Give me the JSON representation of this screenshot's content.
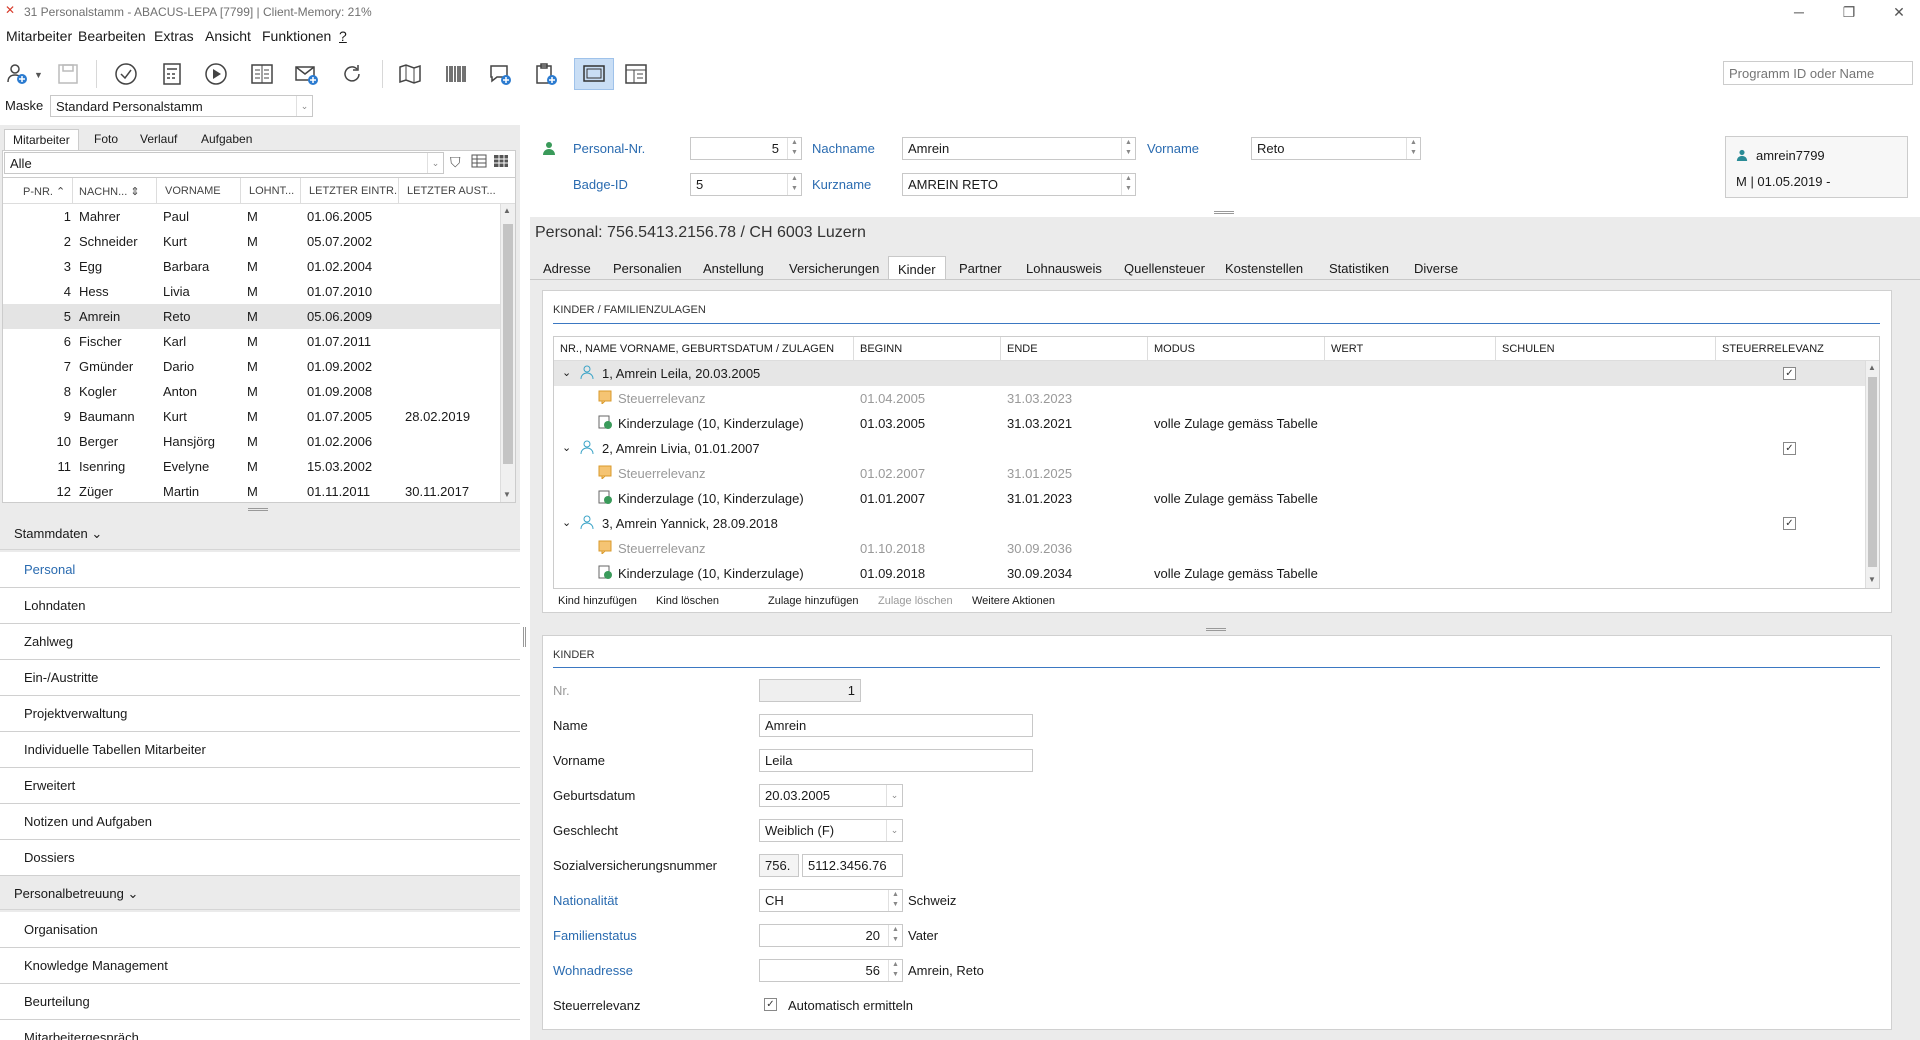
{
  "window": {
    "title": "31 Personalstamm - ABACUS-LEPA [7799] | Client-Memory: 21%"
  },
  "menu": [
    "Mitarbeiter",
    "Bearbeiten",
    "Extras",
    "Ansicht",
    "Funktionen",
    "?"
  ],
  "toolbar": {
    "program_search_placeholder": "Programm ID oder Name",
    "icons": [
      "add-user-icon",
      "save-icon",
      "check-circle-icon",
      "calculator-icon",
      "play-icon",
      "report-icon",
      "mail-icon",
      "refresh-icon",
      "map-icon",
      "barcode-icon",
      "chat-add-icon",
      "clipboard-add-icon",
      "window-icon",
      "layout-icon"
    ]
  },
  "mask": {
    "label": "Maske",
    "value": "Standard Personalstamm"
  },
  "left_tabs": [
    "Mitarbeiter",
    "Foto",
    "Verlauf",
    "Aufgaben"
  ],
  "filter": {
    "value": "Alle"
  },
  "employee_grid": {
    "columns": [
      "P-NR.",
      "NACHN...",
      "VORNAME",
      "LOHNT...",
      "LETZTER EINTR...",
      "LETZTER AUST..."
    ],
    "rows": [
      {
        "nr": "1",
        "nachname": "Mahrer",
        "vorname": "Paul",
        "lohnt": "M",
        "eintritt": "01.06.2005",
        "austritt": ""
      },
      {
        "nr": "2",
        "nachname": "Schneider",
        "vorname": "Kurt",
        "lohnt": "M",
        "eintritt": "05.07.2002",
        "austritt": ""
      },
      {
        "nr": "3",
        "nachname": "Egg",
        "vorname": "Barbara",
        "lohnt": "M",
        "eintritt": "01.02.2004",
        "austritt": ""
      },
      {
        "nr": "4",
        "nachname": "Hess",
        "vorname": "Livia",
        "lohnt": "M",
        "eintritt": "01.07.2010",
        "austritt": ""
      },
      {
        "nr": "5",
        "nachname": "Amrein",
        "vorname": "Reto",
        "lohnt": "M",
        "eintritt": "05.06.2009",
        "austritt": ""
      },
      {
        "nr": "6",
        "nachname": "Fischer",
        "vorname": "Karl",
        "lohnt": "M",
        "eintritt": "01.07.2011",
        "austritt": ""
      },
      {
        "nr": "7",
        "nachname": "Gmünder",
        "vorname": "Dario",
        "lohnt": "M",
        "eintritt": "01.09.2002",
        "austritt": ""
      },
      {
        "nr": "8",
        "nachname": "Kogler",
        "vorname": "Anton",
        "lohnt": "M",
        "eintritt": "01.09.2008",
        "austritt": ""
      },
      {
        "nr": "9",
        "nachname": "Baumann",
        "vorname": "Kurt",
        "lohnt": "M",
        "eintritt": "01.07.2005",
        "austritt": "28.02.2019"
      },
      {
        "nr": "10",
        "nachname": "Berger",
        "vorname": "Hansjörg",
        "lohnt": "M",
        "eintritt": "01.02.2006",
        "austritt": ""
      },
      {
        "nr": "11",
        "nachname": "Isenring",
        "vorname": "Evelyne",
        "lohnt": "M",
        "eintritt": "15.03.2002",
        "austritt": ""
      },
      {
        "nr": "12",
        "nachname": "Züger",
        "vorname": "Martin",
        "lohnt": "M",
        "eintritt": "01.11.2011",
        "austritt": "30.11.2017"
      }
    ],
    "selected_nr": "5"
  },
  "nav": {
    "group1": "Stammdaten",
    "group1_items": [
      "Personal",
      "Lohndaten",
      "Zahlweg",
      "Ein-/Austritte",
      "Projektverwaltung",
      "Individuelle Tabellen Mitarbeiter",
      "Erweitert",
      "Notizen und Aufgaben",
      "Dossiers"
    ],
    "group2": "Personalbetreuung",
    "group2_items": [
      "Organisation",
      "Knowledge Management",
      "Beurteilung",
      "Mitarbeitergespräch"
    ]
  },
  "header": {
    "personal_nr_label": "Personal-Nr.",
    "personal_nr": "5",
    "badge_label": "Badge-ID",
    "badge": "5",
    "nachname_label": "Nachname",
    "nachname": "Amrein",
    "kurzname_label": "Kurzname",
    "kurzname": "AMREIN RETO",
    "vorname_label": "Vorname",
    "vorname": "Reto",
    "user": "amrein7799",
    "user_info": "M | 01.05.2019 -",
    "summary": "Personal: 756.5413.2156.78 / CH 6003 Luzern"
  },
  "tabs": [
    "Adresse",
    "Personalien",
    "Anstellung",
    "Versicherungen",
    "Kinder",
    "Partner",
    "Lohnausweis",
    "Quellensteuer",
    "Kostenstellen",
    "Statistiken",
    "Diverse"
  ],
  "active_tab": "Kinder",
  "kinder_table": {
    "title": "KINDER / FAMILIENZULAGEN",
    "columns": [
      "NR., NAME VORNAME, GEBURTSDATUM / ZULAGEN",
      "BEGINN",
      "ENDE",
      "MODUS",
      "WERT",
      "SCHULEN",
      "STEUERRELEVANZ"
    ],
    "children": [
      {
        "label": "1, Amrein Leila, 20.03.2005",
        "steuer_checked": "✓",
        "items": [
          {
            "name": "Steuerrelevanz",
            "beginn": "01.04.2005",
            "ende": "31.03.2023",
            "modus": "",
            "muted": true
          },
          {
            "name": "Kinderzulage (10, Kinderzulage)",
            "beginn": "01.03.2005",
            "ende": "31.03.2021",
            "modus": "volle Zulage gemäss Tabelle",
            "muted": false
          }
        ]
      },
      {
        "label": "2, Amrein Livia, 01.01.2007",
        "steuer_checked": "✓",
        "items": [
          {
            "name": "Steuerrelevanz",
            "beginn": "01.02.2007",
            "ende": "31.01.2025",
            "modus": "",
            "muted": true
          },
          {
            "name": "Kinderzulage (10, Kinderzulage)",
            "beginn": "01.01.2007",
            "ende": "31.01.2023",
            "modus": "volle Zulage gemäss Tabelle",
            "muted": false
          }
        ]
      },
      {
        "label": "3, Amrein Yannick, 28.09.2018",
        "steuer_checked": "✓",
        "items": [
          {
            "name": "Steuerrelevanz",
            "beginn": "01.10.2018",
            "ende": "30.09.2036",
            "modus": "",
            "muted": true
          },
          {
            "name": "Kinderzulage (10, Kinderzulage)",
            "beginn": "01.09.2018",
            "ende": "30.09.2034",
            "modus": "volle Zulage gemäss Tabelle",
            "muted": false
          }
        ]
      }
    ],
    "actions": [
      "Kind hinzufügen",
      "Kind löschen",
      "Zulage hinzufügen",
      "Zulage löschen",
      "Weitere Aktionen"
    ]
  },
  "kinder_form": {
    "title": "KINDER",
    "nr_label": "Nr.",
    "nr": "1",
    "name_label": "Name",
    "name": "Amrein",
    "vorname_label": "Vorname",
    "vorname": "Leila",
    "geburtsdatum_label": "Geburtsdatum",
    "geburtsdatum": "20.03.2005",
    "geschlecht_label": "Geschlecht",
    "geschlecht": "Weiblich (F)",
    "ahv_label": "Sozialversicherungsnummer",
    "ahv_prefix": "756.",
    "ahv_number": "5112.3456.76",
    "nationalitaet_label": "Nationalität",
    "nationalitaet": "CH",
    "nationalitaet_text": "Schweiz",
    "familienstatus_label": "Familienstatus",
    "familienstatus": "20",
    "familienstatus_text": "Vater",
    "wohnadresse_label": "Wohnadresse",
    "wohnadresse": "56",
    "wohnadresse_text": "Amrein, Reto",
    "steuer_label": "Steuerrelevanz",
    "steuer_checkbox_label": "Automatisch ermitteln",
    "steuer_checked": "✓"
  }
}
